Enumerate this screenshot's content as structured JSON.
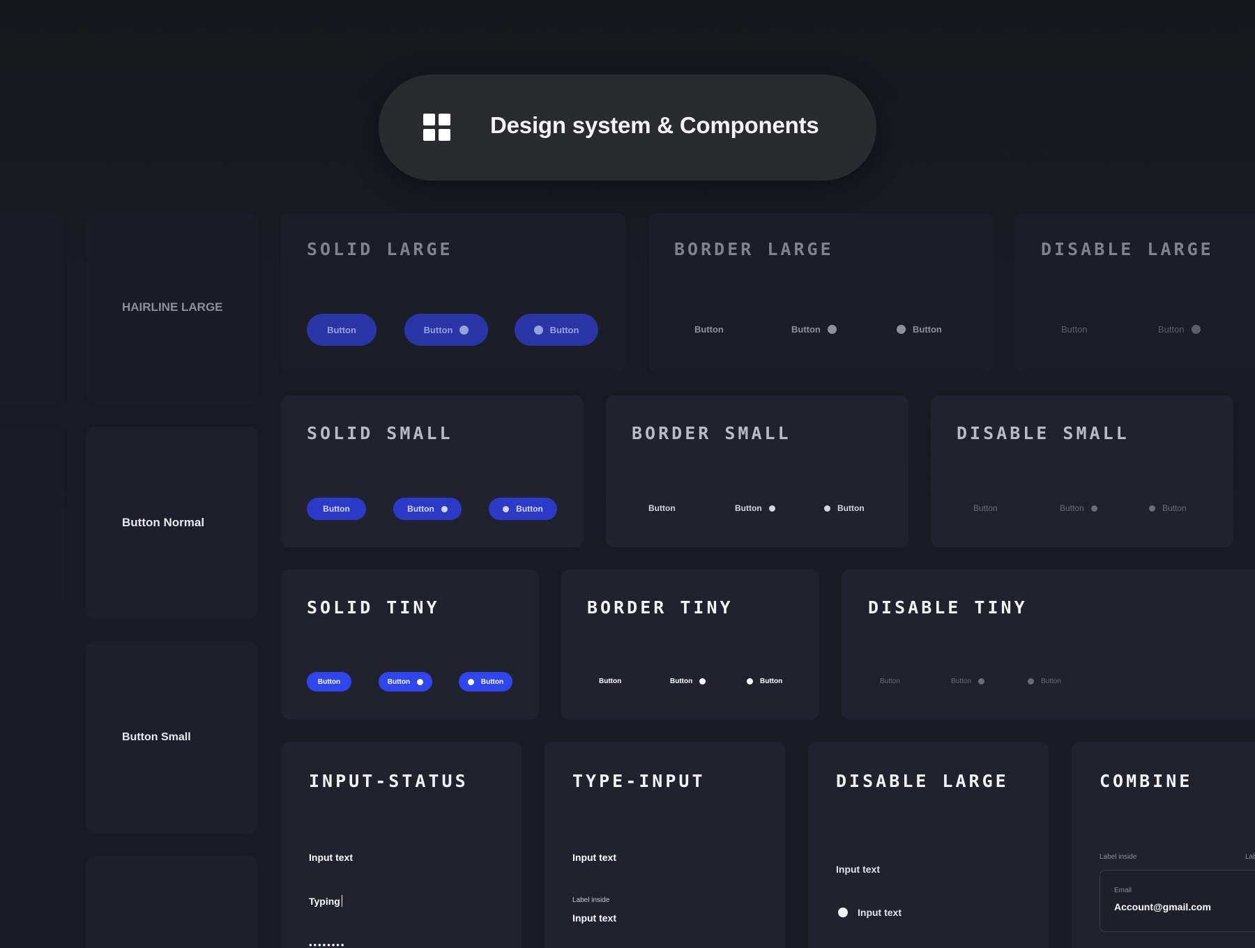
{
  "header": {
    "title": "Design system & Components",
    "icon": "grid-icon"
  },
  "sidebar": {
    "hairline_large": "HAIRLINE LARGE",
    "button_normal": "Button Normal",
    "button_small": "Button Small"
  },
  "cards": {
    "solid_large": {
      "title": "SOLID LARGE",
      "buttons": [
        "Button",
        "Button",
        "Button"
      ]
    },
    "border_large": {
      "title": "BORDER LARGE",
      "buttons": [
        "Button",
        "Button",
        "Button"
      ]
    },
    "disable_large_btn": {
      "title": "DISABLE LARGE",
      "buttons": [
        "Button",
        "Button"
      ]
    },
    "solid_small": {
      "title": "SOLID SMALL",
      "buttons": [
        "Button",
        "Button",
        "Button"
      ]
    },
    "border_small": {
      "title": "BORDER SMALL",
      "buttons": [
        "Button",
        "Button",
        "Button"
      ]
    },
    "disable_small": {
      "title": "DISABLE SMALL",
      "buttons": [
        "Button",
        "Button",
        "Button"
      ]
    },
    "solid_tiny": {
      "title": "SOLID TINY",
      "buttons": [
        "Button",
        "Button",
        "Button"
      ]
    },
    "border_tiny": {
      "title": "BORDER TINY",
      "buttons": [
        "Button",
        "Button",
        "Button"
      ]
    },
    "disable_tiny": {
      "title": "DISABLE TINY",
      "buttons": [
        "Button",
        "Button",
        "Button"
      ]
    },
    "input_status": {
      "title": "INPUT-STATUS",
      "input_text": "Input text",
      "typing": "Typing",
      "password_mask": "••••••••"
    },
    "type_input": {
      "title": "TYPE-INPUT",
      "input_text": "Input text",
      "label_inside": "Label inside",
      "input_text_2": "Input text"
    },
    "disable_large_input": {
      "title": "DISABLE LARGE",
      "input_text": "Input text",
      "radio_text": "Input text"
    },
    "combine": {
      "title": "COMBINE",
      "label_inside": "Label inside",
      "label_inside_cut": "Lab",
      "email_label": "Email",
      "email_value": "Account@gmail.com"
    }
  },
  "colors": {
    "background": "#191b22",
    "card": "#20232e",
    "primary_blue": "#2f45ee",
    "hero_pill": "#2a2b2f"
  }
}
